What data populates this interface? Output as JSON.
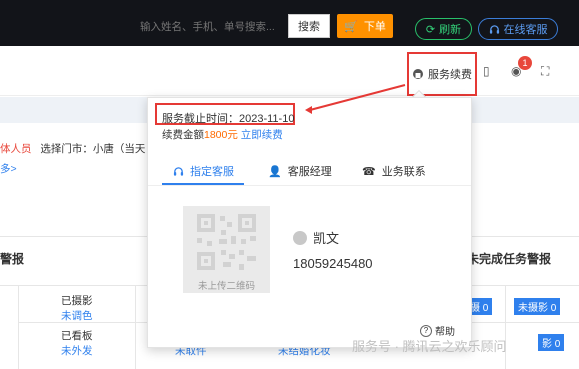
{
  "header": {
    "refresh_label": "刷新",
    "online_service_label": "在线客服"
  },
  "toolbar": {
    "search_placeholder": "输入姓名、手机、单号搜索...",
    "search_label": "搜索",
    "order_label": "下单",
    "renew_label": "服务续费",
    "notification_count": "1"
  },
  "filters": {
    "prefix": "体人员",
    "city_label": "选择门市：小唐（当天",
    "more": "多>"
  },
  "popup": {
    "expiry_label": "服务截止时间：2023-11-10",
    "fee_prefix": "续费金额",
    "fee_amount": "1800元",
    "renew_link": "立即续费",
    "tabs": [
      "指定客服",
      "客服经理",
      "业务联系"
    ],
    "qr_caption": "未上传二维码",
    "agent_name": "凯文",
    "agent_phone": "18059245480",
    "help_label": "帮助"
  },
  "panels": {
    "left_title": "警报",
    "right_title": "未完成任务警报",
    "rows": [
      {
        "status": "已摄影",
        "sub": "未调色"
      },
      {
        "status": "已看板",
        "sub": "未外发"
      }
    ],
    "mid_cells": [
      "未取件",
      "未结婚化妆"
    ],
    "kpis": [
      "摄 0",
      "未摄影 0",
      "影 0"
    ]
  },
  "watermark": "服务号 · 腾讯云之欢乐顾问"
}
